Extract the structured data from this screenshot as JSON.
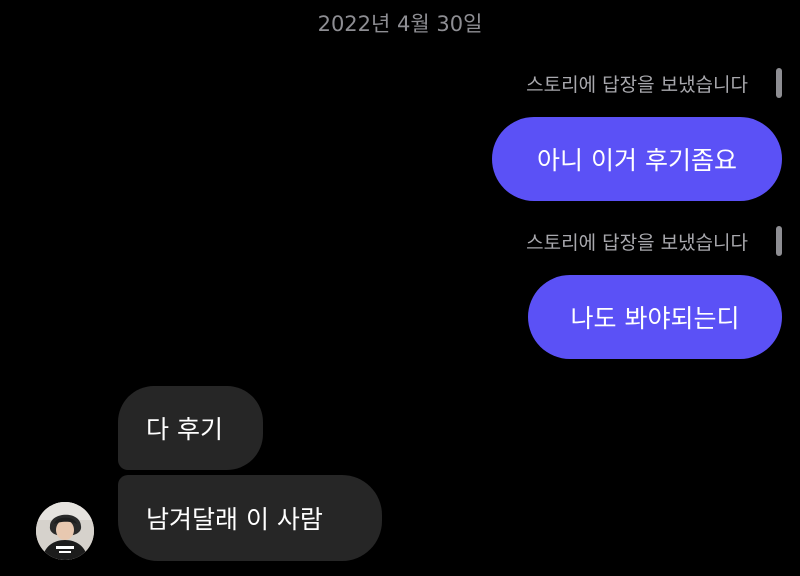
{
  "chat": {
    "date": "2022년 4월 30일",
    "messages": [
      {
        "sender": "me",
        "note": "스토리에 답장을 보냈습니다",
        "text": "아니 이거 후기좀요"
      },
      {
        "sender": "me",
        "note": "스토리에 답장을 보냈습니다",
        "text": "나도 봐야되는디"
      },
      {
        "sender": "other",
        "text": "다 후기"
      },
      {
        "sender": "other",
        "text": "남겨달래 이 사람"
      }
    ]
  },
  "colors": {
    "background": "#000000",
    "outgoing_bubble": "#5b51f6",
    "incoming_bubble": "#262626",
    "secondary_text": "#a8a8ad"
  },
  "icons": {
    "avatar": "user-avatar-photo",
    "story_indicator": "story-reply-bar"
  }
}
